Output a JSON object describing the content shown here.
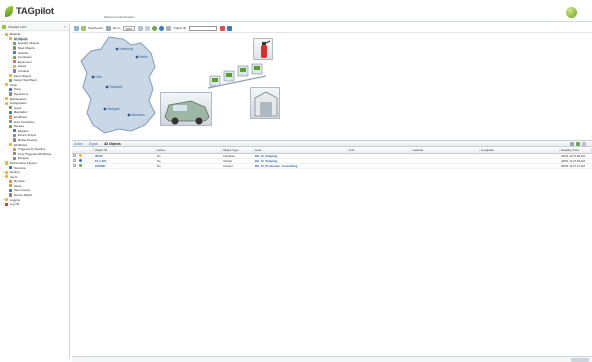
{
  "header": {
    "app_name": "TAGpilot",
    "welcome": "Welcome Administrator"
  },
  "sidebar": {
    "root_label": "TAGpilot 4.0.0",
    "tree": [
      {
        "label": "Material",
        "level": 0,
        "color": "#f2b42a",
        "toggle": "−"
      },
      {
        "label": "All Objects",
        "level": 1,
        "color": "#f2b42a",
        "toggle": "−"
      },
      {
        "label": "Quantity Objects",
        "level": 2,
        "color": "#6aa84f",
        "toggle": ""
      },
      {
        "label": "Steel Objects",
        "level": 2,
        "color": "#888888",
        "toggle": ""
      },
      {
        "label": "Vehicles",
        "level": 2,
        "color": "#3d78c4",
        "toggle": ""
      },
      {
        "label": "Containers",
        "level": 2,
        "color": "#6aa84f",
        "toggle": "+"
      },
      {
        "label": "Equipment",
        "level": 2,
        "color": "#e06666",
        "toggle": "+"
      },
      {
        "label": "Assets",
        "level": 2,
        "color": "#f2b42a",
        "toggle": ""
      },
      {
        "label": "Contacts",
        "level": 2,
        "color": "#8e7cc3",
        "toggle": ""
      },
      {
        "label": "Issue Objects",
        "level": 1,
        "color": "#f2b42a",
        "toggle": ""
      },
      {
        "label": "Assign Tag/Object",
        "level": 1,
        "color": "#6aa84f",
        "toggle": ""
      },
      {
        "label": "Track",
        "level": 0,
        "color": "#f2b42a",
        "toggle": "−"
      },
      {
        "label": "Trace",
        "level": 1,
        "color": "#3d78c4",
        "toggle": ""
      },
      {
        "label": "Tag History",
        "level": 1,
        "color": "#888888",
        "toggle": ""
      },
      {
        "label": "Maintenance",
        "level": 0,
        "color": "#f2b42a",
        "toggle": "+"
      },
      {
        "label": "Configuration",
        "level": 0,
        "color": "#f2b42a",
        "toggle": "−"
      },
      {
        "label": "Areas",
        "level": 1,
        "color": "#6aa84f",
        "toggle": ""
      },
      {
        "label": "Map Editor",
        "level": 1,
        "color": "#3d78c4",
        "toggle": ""
      },
      {
        "label": "Workflows",
        "level": 1,
        "color": "#e69138",
        "toggle": ""
      },
      {
        "label": "Area Transitions",
        "level": 1,
        "color": "#888888",
        "toggle": ""
      },
      {
        "label": "Devices",
        "level": 1,
        "color": "#6aa84f",
        "toggle": "−"
      },
      {
        "label": "Readers",
        "level": 2,
        "color": "#3d78c4",
        "toggle": ""
      },
      {
        "label": "Device Scripts",
        "level": 2,
        "color": "#888888",
        "toggle": ""
      },
      {
        "label": "Mobile Devices",
        "level": 2,
        "color": "#888888",
        "toggle": ""
      },
      {
        "label": "Workflows",
        "level": 1,
        "color": "#f2b42a",
        "toggle": "−"
      },
      {
        "label": "Triggered by Reading",
        "level": 2,
        "color": "#e69138",
        "toggle": ""
      },
      {
        "label": "Time Triggered Workflows",
        "level": 2,
        "color": "#888888",
        "toggle": ""
      },
      {
        "label": "Designer",
        "level": 2,
        "color": "#888888",
        "toggle": ""
      },
      {
        "label": "Performance Figures",
        "level": 0,
        "color": "#f2b42a",
        "toggle": "−"
      },
      {
        "label": "Overview",
        "level": 1,
        "color": "#3d78c4",
        "toggle": ""
      },
      {
        "label": "Alerting",
        "level": 0,
        "color": "#f2b42a",
        "toggle": "+"
      },
      {
        "label": "Users",
        "level": 0,
        "color": "#f2b42a",
        "toggle": "−"
      },
      {
        "label": "My Data",
        "level": 1,
        "color": "#e69138",
        "toggle": ""
      },
      {
        "label": "Users",
        "level": 1,
        "color": "#e69138",
        "toggle": ""
      },
      {
        "label": "User Groups",
        "level": 1,
        "color": "#3d78c4",
        "toggle": ""
      },
      {
        "label": "Access Rights",
        "level": 1,
        "color": "#888888",
        "toggle": ""
      },
      {
        "label": "Logging",
        "level": 0,
        "color": "#f2b42a",
        "toggle": "+"
      },
      {
        "label": "Log Off",
        "level": 0,
        "color": "#cc3333",
        "toggle": ""
      }
    ]
  },
  "toolbar": {
    "dashboard_label": "Dashboard",
    "zoom_label": "Zoom",
    "zoom_value": "100%",
    "objectid_label": "Object ID"
  },
  "map": {
    "cities": [
      "Hamburg",
      "Berlin",
      "Köln",
      "Frankfurt",
      "Stuttgart",
      "München"
    ]
  },
  "tabs": {
    "items": [
      "Action",
      "Export",
      "All Objects"
    ]
  },
  "grid": {
    "columns": [
      "",
      "Object ID",
      "Active",
      "Object Type",
      "Area",
      "Unit",
      "Latitude",
      "Longitude",
      "Reading Time"
    ],
    "rows": [
      [
        "",
        "00010",
        "No",
        "Container",
        "BH_10_Shipping",
        "",
        "",
        "",
        "4/8/11 11:37:28 AM"
      ],
      [
        "",
        "FA 1-207",
        "No",
        "Vehicle",
        "BH_10_Shipping",
        "",
        "",
        "",
        "4/8/11 11:37:28 AM"
      ],
      [
        "",
        "2116807",
        "No",
        "Content",
        "BH_10_Production_Assembling",
        "",
        "",
        "",
        "4/8/11 11:37:27 AM"
      ]
    ]
  }
}
